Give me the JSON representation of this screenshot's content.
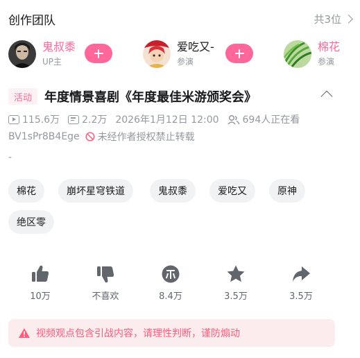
{
  "team": {
    "title": "创作团队",
    "count_label": "共3位"
  },
  "creators": [
    {
      "name": "鬼叔黍",
      "role": "UP主",
      "name_color": "#ff6699",
      "has_follow": true,
      "avatar_icon": "portrait-avatar"
    },
    {
      "name": "爱吃又-",
      "role": "参演",
      "name_color": "#18191c",
      "has_follow": true,
      "avatar_icon": "character-avatar"
    },
    {
      "name": "棉花",
      "role": "参演",
      "name_color": "#ff6699",
      "has_follow": false,
      "avatar_icon": "green-vegetable-avatar"
    }
  ],
  "video": {
    "badge": "活动",
    "title": "年度情景喜剧《年度最佳米游颁奖会》",
    "views": "115.6万",
    "danmaku": "2.2万",
    "datetime": "2026年1月12日 12:00",
    "watching": "694人正在看",
    "bvid": "BV1sPr8B4Ege",
    "copyright": "未经作者授权禁止转载",
    "description": "-"
  },
  "tags": [
    "棉花",
    "崩坏星穹铁道",
    "鬼叔黍",
    "爱吃又",
    "原神",
    "绝区零"
  ],
  "actions": [
    {
      "icon": "thumbs-up-icon",
      "label": "10万"
    },
    {
      "icon": "thumbs-down-icon",
      "label": "不喜欢"
    },
    {
      "icon": "coin-icon",
      "label": "8.4万"
    },
    {
      "icon": "star-icon",
      "label": "3.5万"
    },
    {
      "icon": "share-icon",
      "label": "3.5万"
    }
  ],
  "notice": {
    "text": "视频观点包含引战内容，请理性判断，谨防煽动",
    "color": "#ff5c7c"
  },
  "colors": {
    "accent": "#ff6699",
    "muted": "#9499a0",
    "icon": "#61666d",
    "tag_bg": "#f1f2f3",
    "notice_bg": "#fbecee"
  }
}
